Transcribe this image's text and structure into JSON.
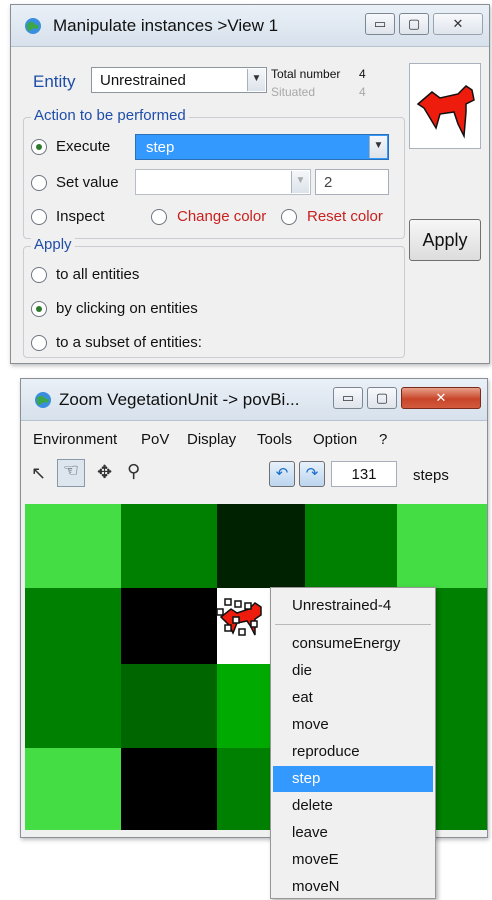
{
  "manip": {
    "title": "Manipulate instances >View 1",
    "entity_label": "Entity",
    "entity_value": "Unrestrained",
    "total_label": "Total number",
    "total_value": "4",
    "situated_label": "Situated",
    "situated_value": "4",
    "action_group": "Action to be performed",
    "execute_label": "Execute",
    "execute_value": "step",
    "setvalue_label": "Set value",
    "setvalue_value": "2",
    "inspect_label": "Inspect",
    "change_color_label": "Change color",
    "reset_color_label": "Reset color",
    "apply_group": "Apply",
    "apply_all": "to all entities",
    "apply_click": "by clicking on entities",
    "apply_subset": "to a subset of entities:",
    "apply_button": "Apply",
    "entity_color": "#ee1c0c"
  },
  "zoom": {
    "title": "Zoom VegetationUnit -> povBi...",
    "menu": [
      "Environment",
      "PoV",
      "Display",
      "Tools",
      "Option",
      "?"
    ],
    "steps_value": "131",
    "steps_label": "steps",
    "grid_colors": [
      [
        "#44dd44",
        "#008000",
        "#002200",
        "#008000",
        "#44dd44"
      ],
      [
        "#008000",
        "#000000",
        "#ffffff",
        "#008000",
        "#008000"
      ],
      [
        "#008000",
        "#006600",
        "#00aa00",
        "#008000",
        "#008000"
      ],
      [
        "#44dd44",
        "#000000",
        "#008000",
        "#008000",
        "#008000"
      ]
    ]
  },
  "context_menu": {
    "header": "Unrestrained-4",
    "items": [
      "consumeEnergy",
      "die",
      "eat",
      "move",
      "reproduce",
      "step",
      "delete",
      "leave",
      "moveE",
      "moveN"
    ],
    "selected": "step"
  }
}
